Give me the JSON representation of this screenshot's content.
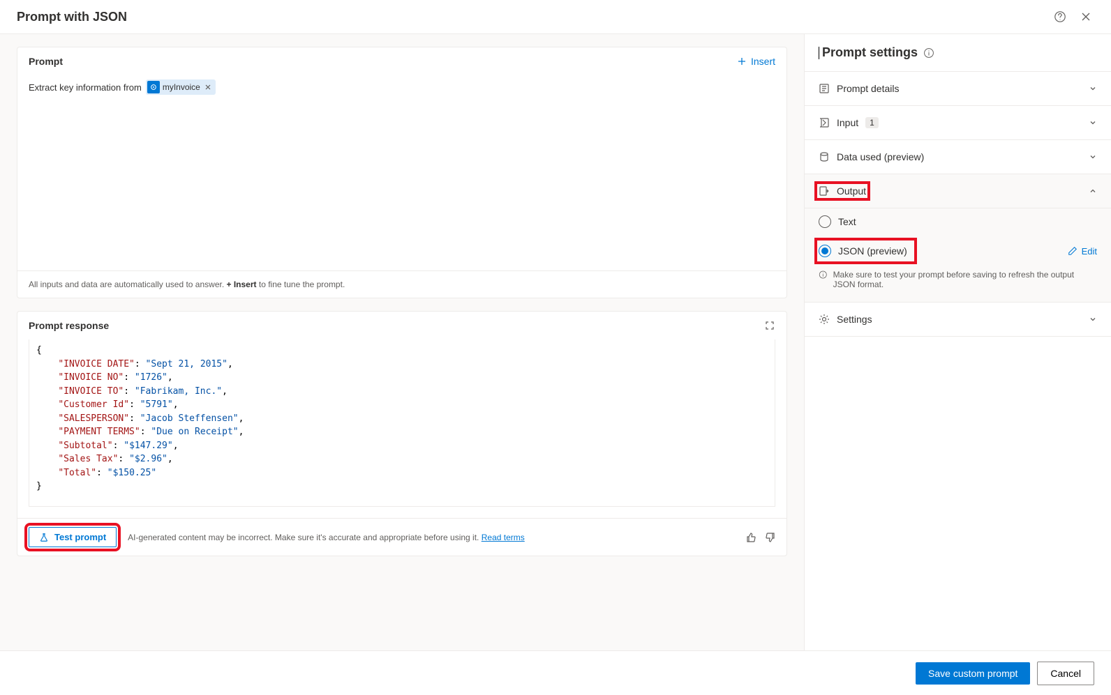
{
  "header": {
    "title": "Prompt with JSON"
  },
  "prompt": {
    "title": "Prompt",
    "insert_label": "Insert",
    "text_prefix": "Extract key information from",
    "chip_label": "myInvoice",
    "hint_prefix": "All inputs and data are automatically used to answer. ",
    "hint_strong": "+ Insert",
    "hint_suffix": " to fine tune the prompt."
  },
  "response": {
    "title": "Prompt response",
    "json_lines": [
      {
        "key": "INVOICE DATE",
        "value": "Sept 21, 2015"
      },
      {
        "key": "INVOICE NO",
        "value": "1726"
      },
      {
        "key": "INVOICE TO",
        "value": "Fabrikam, Inc."
      },
      {
        "key": "Customer Id",
        "value": "5791"
      },
      {
        "key": "SALESPERSON",
        "value": "Jacob Steffensen"
      },
      {
        "key": "PAYMENT TERMS",
        "value": "Due on Receipt"
      },
      {
        "key": "Subtotal",
        "value": "$147.29"
      },
      {
        "key": "Sales Tax",
        "value": "$2.96"
      },
      {
        "key": "Total",
        "value": "$150.25"
      }
    ],
    "test_label": "Test prompt",
    "disclaimer_text": "AI-generated content may be incorrect. Make sure it's accurate and appropriate before using it. ",
    "disclaimer_link": "Read terms"
  },
  "settings": {
    "title": "Prompt settings",
    "items": {
      "details": "Prompt details",
      "input": "Input",
      "input_badge": "1",
      "data_used": "Data used (preview)",
      "output": "Output",
      "settings": "Settings"
    },
    "output": {
      "text_label": "Text",
      "json_label": "JSON (preview)",
      "edit_label": "Edit",
      "info_text": "Make sure to test your prompt before saving to refresh the output JSON format."
    }
  },
  "footer": {
    "save_label": "Save custom prompt",
    "cancel_label": "Cancel"
  }
}
